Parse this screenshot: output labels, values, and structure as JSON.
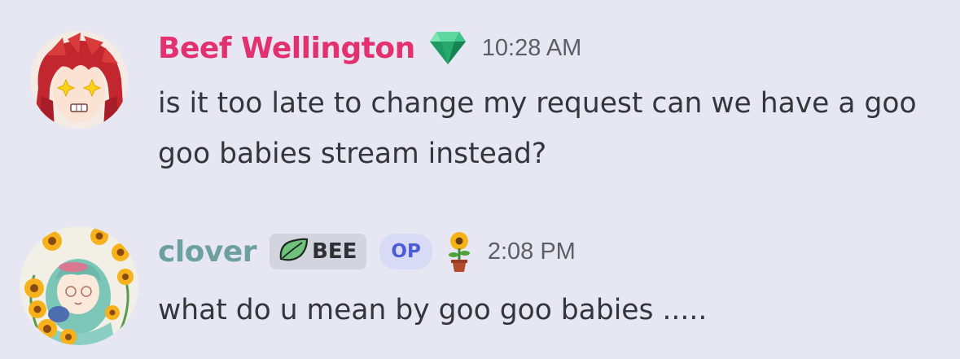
{
  "messages": [
    {
      "author": "Beef Wellington",
      "author_color": "#e3306f",
      "avatar": "red-haired-anime-avatar",
      "badge_icon": "emerald-gem-icon",
      "timestamp": "10:28 AM",
      "text": "is it too late to change my request can we have a goo goo babies stream instead?"
    },
    {
      "author": "clover",
      "author_color": "#6ea19e",
      "avatar": "sunflower-anime-avatar",
      "tag_icon": "leaf-icon",
      "tag_label": "BEE",
      "op_label": "OP",
      "role_icon": "potted-sunflower-icon",
      "timestamp": "2:08 PM",
      "text": "what do u mean by goo goo babies ....."
    }
  ],
  "colors": {
    "background": "#e6e7f2",
    "message_text": "#34363c",
    "timestamp": "#5c5e66",
    "op_badge_bg": "#d8daf6",
    "op_badge_text": "#4d5bd6",
    "tag_bg": "#d3d5de"
  }
}
